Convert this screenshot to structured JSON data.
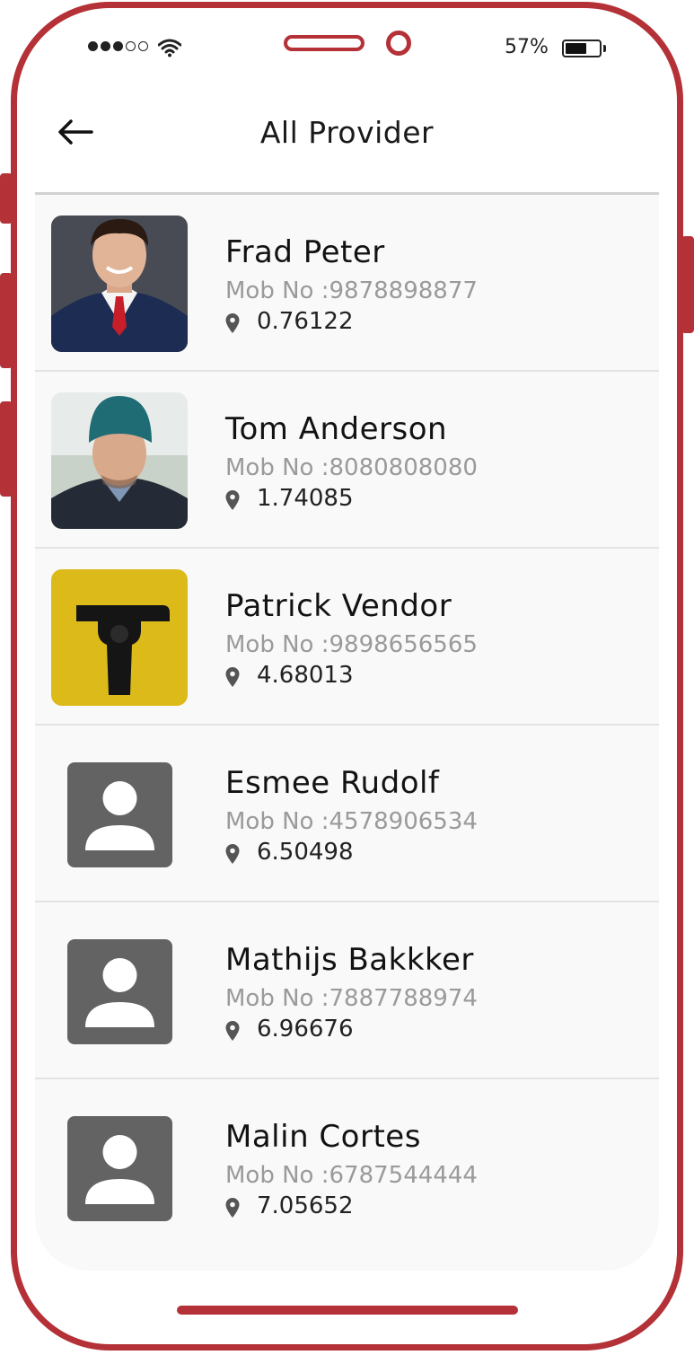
{
  "status_bar": {
    "battery_percent": "57%",
    "signal_strength": 3,
    "signal_total": 5
  },
  "header": {
    "title": "All Provider",
    "back_icon": "arrow-left-icon"
  },
  "colors": {
    "frame": "#b33137",
    "placeholder": "#636363",
    "muted_text": "#9a9a9a"
  },
  "providers": [
    {
      "name": "Frad Peter",
      "mobile": "Mob No :9878898877",
      "distance": "0.76122",
      "avatar": "photo"
    },
    {
      "name": "Tom Anderson",
      "mobile": "Mob No :8080808080",
      "distance": "1.74085",
      "avatar": "photo"
    },
    {
      "name": "Patrick Vendor",
      "mobile": "Mob No :9898656565",
      "distance": "4.68013",
      "avatar": "photo"
    },
    {
      "name": "Esmee Rudolf",
      "mobile": "Mob No :4578906534",
      "distance": "6.50498",
      "avatar": "placeholder"
    },
    {
      "name": "Mathijs Bakkker",
      "mobile": "Mob No :7887788974",
      "distance": "6.96676",
      "avatar": "placeholder"
    },
    {
      "name": "Malin Cortes",
      "mobile": "Mob No :6787544444",
      "distance": "7.05652",
      "avatar": "placeholder"
    }
  ]
}
